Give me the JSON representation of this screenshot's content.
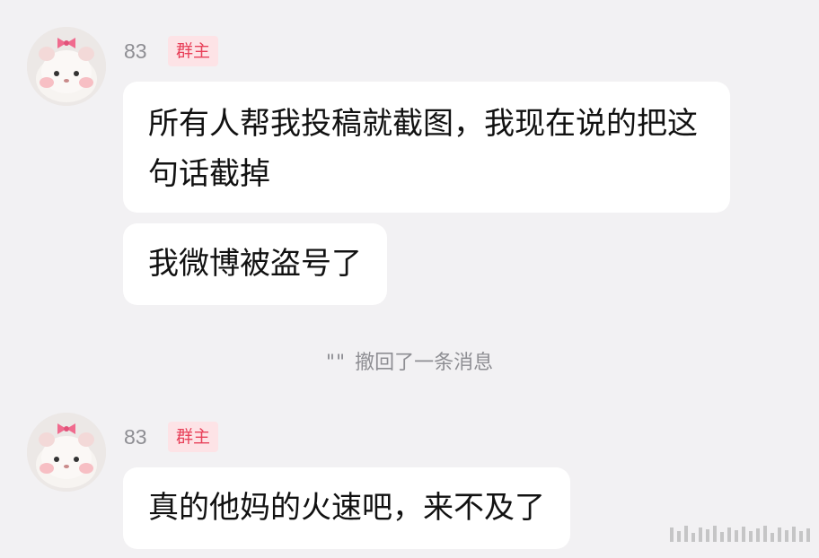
{
  "messages": [
    {
      "sender": "83",
      "badge": "群主",
      "bubbles": [
        "所有人帮我投稿就截图，我现在说的把这句话截掉",
        "我微博被盗号了"
      ]
    },
    {
      "sender": "83",
      "badge": "群主",
      "bubbles": [
        "真的他妈的火速吧，来不及了"
      ]
    }
  ],
  "system_notice": {
    "quotes": "\"\"",
    "text": "撤回了一条消息"
  },
  "colors": {
    "background": "#f2f1f3",
    "bubble": "#ffffff",
    "badge_bg": "#fde3e6",
    "badge_text": "#e8415a",
    "secondary_text": "#8e8e93"
  }
}
